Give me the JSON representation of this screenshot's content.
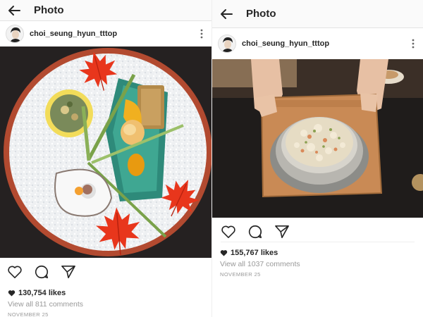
{
  "posts": [
    {
      "header_title": "Photo",
      "username": "choi_seung_hyun_tttop",
      "likes": "130,754 likes",
      "comments": "View all 811 comments",
      "date": "NOVEMBER 25"
    },
    {
      "header_title": "Photo",
      "username": "choi_seung_hyun_tttop",
      "likes": "155,767 likes",
      "comments": "View all 1037 comments",
      "date": "NOVEMBER 25"
    }
  ],
  "icons": {
    "back": "arrow-left-icon",
    "more": "more-vertical-icon",
    "like": "heart-outline-icon",
    "comment": "comment-bubble-icon",
    "share": "send-paper-plane-icon",
    "likes_marker": "heart-filled-icon"
  },
  "colors": {
    "text": "#262626",
    "muted": "#999999",
    "topbar": "#fafafa",
    "maple_leaf": "#e8361c",
    "plate_rim": "#b24a30"
  }
}
